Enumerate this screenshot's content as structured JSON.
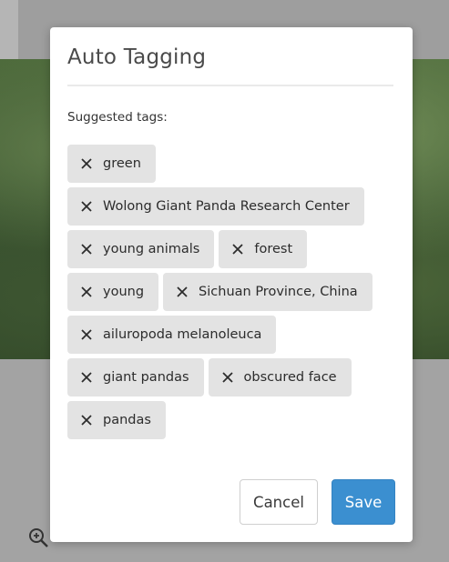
{
  "dialog": {
    "title": "Auto Tagging",
    "section_label": "Suggested tags:",
    "tag_rows": [
      [
        "green"
      ],
      [
        "Wolong Giant Panda Research Center"
      ],
      [
        "young animals",
        "forest"
      ],
      [
        "young",
        "Sichuan Province, China"
      ],
      [
        "ailuropoda melanoleuca"
      ],
      [
        "giant pandas",
        "obscured face"
      ],
      [
        "pandas"
      ]
    ],
    "remove_icon": "close-icon",
    "cancel_label": "Cancel",
    "save_label": "Save"
  },
  "colors": {
    "save_button": "#3b8fd0",
    "tag_background": "#e3e3e3",
    "overlay": "#9e9e9e"
  }
}
